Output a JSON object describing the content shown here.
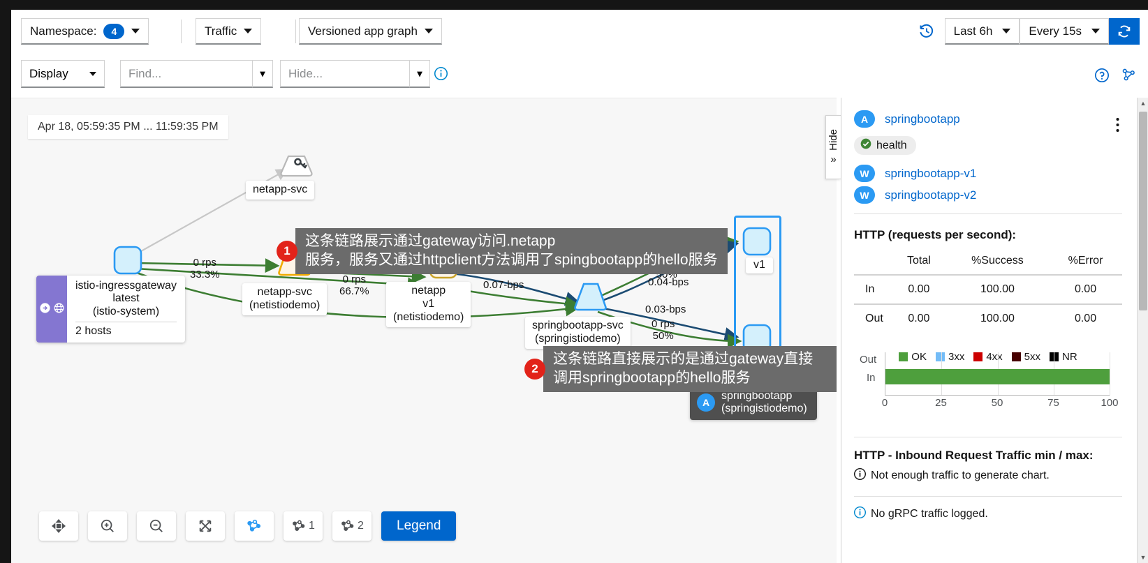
{
  "toolbar": {
    "namespace_label": "Namespace:",
    "namespace_count": "4",
    "traffic_label": "Traffic",
    "graph_type": "Versioned app graph",
    "time_range": "Last 6h",
    "refresh_interval": "Every 15s",
    "refresh_icon": "refresh-icon",
    "history_icon": "history-icon"
  },
  "toolbar2": {
    "display_label": "Display",
    "find_placeholder": "Find...",
    "hide_placeholder": "Hide...",
    "info_icon": "info-circle-icon",
    "help_icon": "help-circle-icon",
    "settings_icon": "graph-settings-icon"
  },
  "graph": {
    "time_window": "Apr 18, 05:59:35 PM ... 11:59:35 PM",
    "hide_tab_label": "Hide",
    "nodes": {
      "netapp_svc_top": "netapp-svc",
      "ingressgateway": {
        "line1": "istio-ingressgateway",
        "line2": "latest",
        "line3": "(istio-system)",
        "hosts": "2 hosts"
      },
      "netapp_svc": {
        "line1": "netapp-svc",
        "line2": "(netistiodemo)"
      },
      "netapp_v1": {
        "line1": "netapp",
        "line2": "v1",
        "line3": "(netistiodemo)"
      },
      "springbootapp_svc": {
        "line1": "springbootapp-svc",
        "line2": "(springistiodemo)"
      },
      "v1_label": "v1",
      "springbootapp_box": {
        "badge": "A",
        "line1": "springbootapp",
        "line2": "(springistiodemo)"
      }
    },
    "edges": [
      {
        "name": "gw-to-netapp-svc",
        "rate": "0 rps",
        "pct": "33.3%"
      },
      {
        "name": "gw-to-netapp-v1",
        "rate": "0 rps",
        "pct": "66.7%"
      },
      {
        "name": "netapp-to-sbsvc-bps",
        "rate": "0.07-bps",
        "pct": ""
      },
      {
        "name": "sbsvc-to-v1-rps",
        "rate": "0 rps",
        "pct": "50%"
      },
      {
        "name": "sbsvc-to-v1-bps",
        "rate": "0.04-bps",
        "pct": ""
      },
      {
        "name": "sbsvc-to-v2-bps",
        "rate": "0.03-bps",
        "pct": ""
      },
      {
        "name": "sbsvc-to-v2-rps",
        "rate": "0 rps",
        "pct": "50%"
      }
    ],
    "annotations": [
      {
        "num": "1",
        "line1": "这条链路展示通过gateway访问.netapp",
        "line2": "服务，服务又通过httpclient方法调用了spingbootapp的hello服务"
      },
      {
        "num": "2",
        "line1": "这条链路直接展示的是通过gateway直接调用springbootapp的hello服务",
        "line2": ""
      }
    ],
    "tools": {
      "fit_icon": "fit-to-screen-icon",
      "zoom_in_icon": "zoom-in-icon",
      "zoom_out_icon": "zoom-out-icon",
      "expand_icon": "expand-icon",
      "layout_default_icon": "layout-dagre-icon",
      "layout1_icon": "layout-cose-icon",
      "layout1_label": "1",
      "layout2_icon": "layout-cola-icon",
      "layout2_label": "2",
      "legend_label": "Legend"
    }
  },
  "sidebar": {
    "app_badge": "A",
    "app_name": "springbootapp",
    "kebab_icon": "kebab-menu-icon",
    "health_label": "health",
    "health_icon": "check-circle-icon",
    "workloads": [
      {
        "badge": "W",
        "name": "springbootapp-v1"
      },
      {
        "badge": "W",
        "name": "springbootapp-v2"
      }
    ],
    "http_title": "HTTP (requests per second):",
    "http_table": {
      "headers": [
        "",
        "Total",
        "%Success",
        "%Error"
      ],
      "rows": [
        {
          "label": "In",
          "total": "0.00",
          "success": "100.00",
          "error": "0.00"
        },
        {
          "label": "Out",
          "total": "0.00",
          "success": "100.00",
          "error": "0.00"
        }
      ]
    },
    "inbound_title": "HTTP - Inbound Request Traffic min / max:",
    "inbound_note": "Not enough traffic to generate chart.",
    "grpc_note": "No gRPC traffic logged.",
    "info_icon": "info-circle-icon"
  },
  "chart_data": {
    "type": "bar",
    "title": "",
    "categories": [
      "Out",
      "In"
    ],
    "values": [
      0,
      100
    ],
    "xlabel": "",
    "ylabel": "",
    "xlim": [
      0,
      100
    ],
    "xticks": [
      "0",
      "25",
      "50",
      "75",
      "100"
    ],
    "grid": true,
    "orientation": "horizontal",
    "legend_position": "bottom",
    "legend": [
      {
        "label": "OK",
        "color": "#4e9f3d"
      },
      {
        "label": "3xx",
        "color": "#73bcf7"
      },
      {
        "label": "4xx",
        "color": "#cc0000"
      },
      {
        "label": "5xx",
        "color": "#470000"
      },
      {
        "label": "NR",
        "color": "#030303"
      }
    ]
  }
}
